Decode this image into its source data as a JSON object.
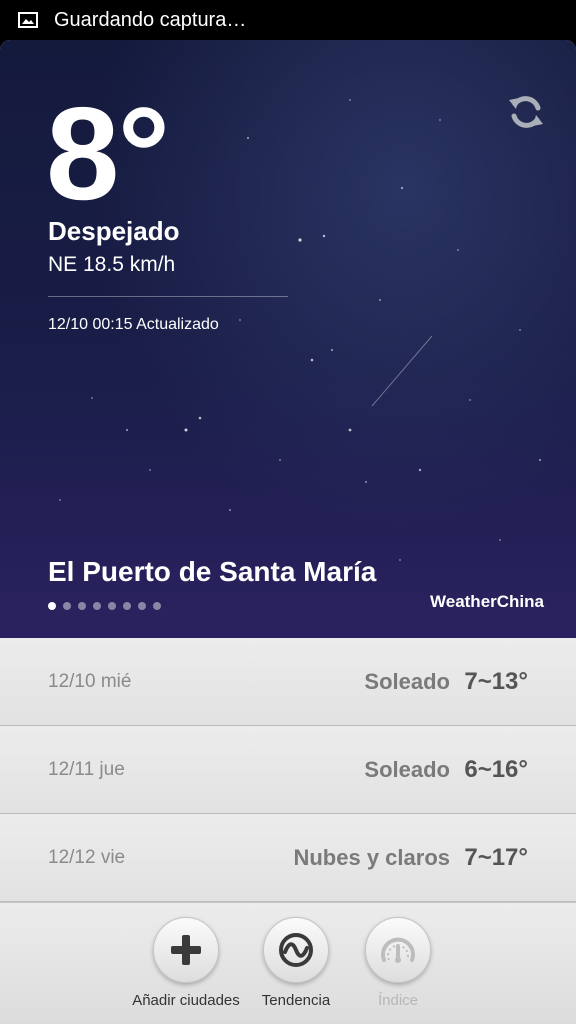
{
  "status_bar": {
    "text": "Guardando captura…",
    "icon": "image-icon"
  },
  "weather": {
    "temperature": "8°",
    "condition": "Despejado",
    "wind": "NE 18.5 km/h",
    "updated": "12/10 00:15 Actualizado",
    "city": "El Puerto de Santa María",
    "source": "WeatherChina",
    "page_dots": {
      "count": 8,
      "active": 1
    }
  },
  "forecast": [
    {
      "date": "12/10 mié",
      "condition": "Soleado",
      "range": "7~13°"
    },
    {
      "date": "12/11 jue",
      "condition": "Soleado",
      "range": "6~16°"
    },
    {
      "date": "12/12 vie",
      "condition": "Nubes y claros",
      "range": "7~17°"
    }
  ],
  "toolbar": {
    "add_city": "Añadir ciudades",
    "trend": "Tendencia",
    "index": "Índice"
  }
}
